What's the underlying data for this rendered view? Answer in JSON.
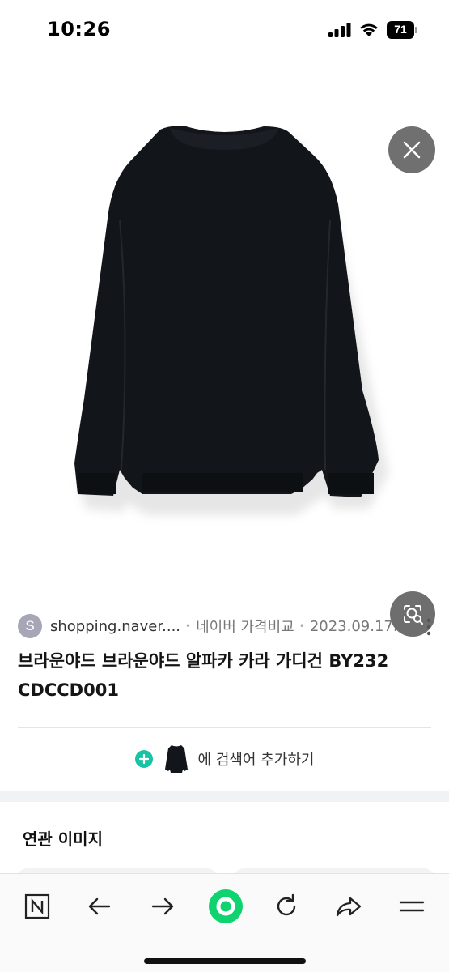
{
  "status_bar": {
    "time": "10:26",
    "battery_level": "71"
  },
  "image": {
    "subject": "black knit alpaca cardigan"
  },
  "result": {
    "source_avatar_letter": "S",
    "source_domain": "shopping.naver....",
    "separator": "•",
    "source_name": "네이버 가격비교",
    "date": "2023.09.17.",
    "title": "브라운야드 브라운야드 알파카 카라 가디건 BY232 CDCCD001"
  },
  "add_search": {
    "text": "에 검색어 추가하기"
  },
  "related": {
    "title": "연관 이미지"
  },
  "toolbar": {
    "items": [
      "naver-home-icon",
      "back-arrow-icon",
      "forward-arrow-icon",
      "green-dot-icon",
      "refresh-icon",
      "share-icon",
      "menu-icon"
    ]
  },
  "colors": {
    "accent_green": "#19c3a5",
    "toolbar_green": "#0ed36e",
    "overlay_button": "#707070"
  }
}
